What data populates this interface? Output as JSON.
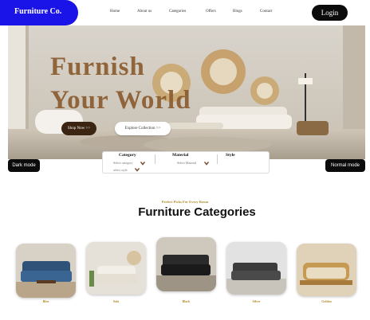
{
  "header": {
    "logo": "Furniture Co.",
    "nav": [
      "Home",
      "About us",
      "Categories",
      "Offers",
      "Blogs",
      "Contact"
    ],
    "login": "Login"
  },
  "hero": {
    "title_line1": "Furnish",
    "title_line2": "Your World",
    "shop_btn": "Shop Now >>",
    "explore_btn": "Explore Collection >>"
  },
  "filter": {
    "category_label": "Category",
    "category_select": "Select category",
    "material_label": "Material",
    "material_select": "Select Material",
    "style_label": "Style",
    "style_select": "select style"
  },
  "modes": {
    "dark": "Dark mode",
    "normal": "Normal mode"
  },
  "categories": {
    "subtitle": "Perfect Picks For Every Room",
    "title": "Furniture Categories",
    "items": [
      {
        "label": "Blue"
      },
      {
        "label": "Sofa"
      },
      {
        "label": "Black"
      },
      {
        "label": "Silver"
      },
      {
        "label": "Golden"
      }
    ]
  },
  "colors": {
    "brand": "#1a14e8",
    "accent": "#b38b2c",
    "dark": "#0b0b0b",
    "shop": "#3b2512"
  }
}
